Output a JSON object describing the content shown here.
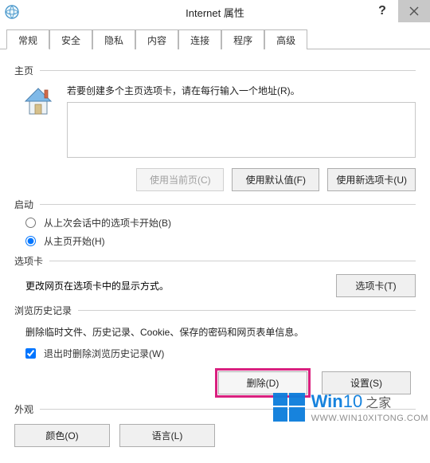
{
  "titlebar": {
    "title": "Internet 属性"
  },
  "tabs": {
    "items": [
      {
        "label": "常规",
        "active": true
      },
      {
        "label": "安全"
      },
      {
        "label": "隐私"
      },
      {
        "label": "内容"
      },
      {
        "label": "连接"
      },
      {
        "label": "程序"
      },
      {
        "label": "高级"
      }
    ]
  },
  "homepage": {
    "heading": "主页",
    "hint": "若要创建多个主页选项卡，请在每行输入一个地址(R)。",
    "textarea_value": "",
    "buttons": {
      "use_current": "使用当前页(C)",
      "use_default": "使用默认值(F)",
      "use_newtab": "使用新选项卡(U)"
    }
  },
  "startup": {
    "heading": "启动",
    "option_lastsession": "从上次会话中的选项卡开始(B)",
    "option_homepage": "从主页开始(H)",
    "selected": "homepage"
  },
  "tabs_section": {
    "heading": "选项卡",
    "desc": "更改网页在选项卡中的显示方式。",
    "button": "选项卡(T)"
  },
  "history": {
    "heading": "浏览历史记录",
    "desc": "删除临时文件、历史记录、Cookie、保存的密码和网页表单信息。",
    "checkbox": "退出时删除浏览历史记录(W)",
    "checkbox_checked": true,
    "buttons": {
      "delete": "删除(D)",
      "settings": "设置(S)"
    }
  },
  "appearance": {
    "heading": "外观",
    "buttons": {
      "colors": "颜色(O)",
      "languages": "语言(L)"
    }
  },
  "watermark": {
    "brand1": "Win",
    "brand2": "10",
    "brand3": "之家",
    "url": "WWW.WIN10XITONG.COM"
  }
}
